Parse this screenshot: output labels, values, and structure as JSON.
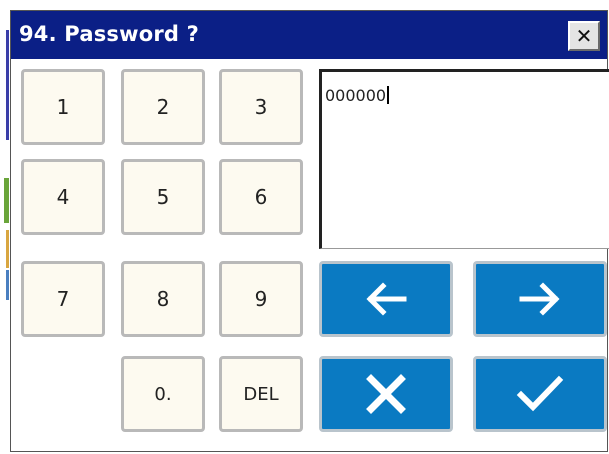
{
  "dialog": {
    "title": "94. Password ?",
    "close_icon": "close-icon"
  },
  "keypad": {
    "keys": [
      "1",
      "2",
      "3",
      "4",
      "5",
      "6",
      "7",
      "8",
      "9",
      "0.",
      "DEL"
    ]
  },
  "display": {
    "value": "000000"
  },
  "actions": {
    "left_icon": "arrow-left-icon",
    "right_icon": "arrow-right-icon",
    "cancel_icon": "x-icon",
    "ok_icon": "checkmark-icon"
  },
  "colors": {
    "titlebar": "#0b1f86",
    "action_button": "#0a7ac2",
    "key_face": "#fdfaf0"
  }
}
